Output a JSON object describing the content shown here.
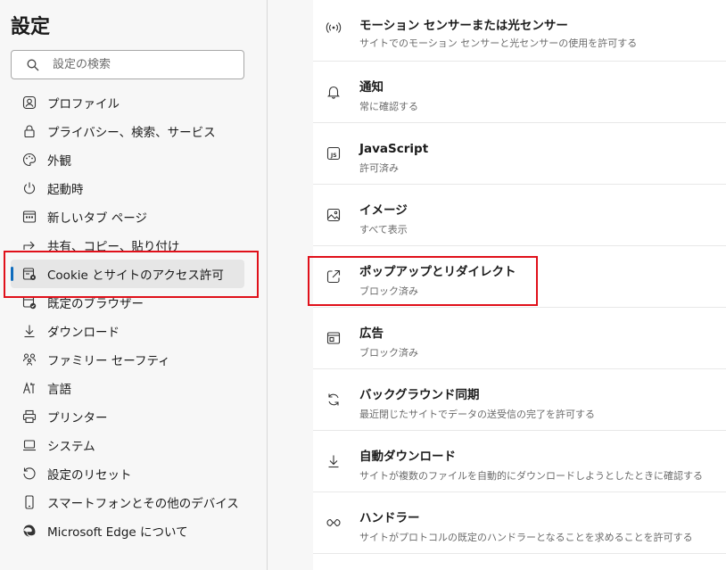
{
  "sidebar": {
    "title": "設定",
    "search_placeholder": "設定の検索",
    "items": [
      {
        "label": "プロファイル",
        "icon": "profile-icon"
      },
      {
        "label": "プライバシー、検索、サービス",
        "icon": "lock-icon"
      },
      {
        "label": "外観",
        "icon": "palette-icon"
      },
      {
        "label": "起動時",
        "icon": "power-icon"
      },
      {
        "label": "新しいタブ ページ",
        "icon": "new-tab-icon"
      },
      {
        "label": "共有、コピー、貼り付け",
        "icon": "share-icon"
      },
      {
        "label": "Cookie とサイトのアクセス許可",
        "icon": "site-permissions-icon",
        "active": true
      },
      {
        "label": "既定のブラウザー",
        "icon": "default-browser-icon"
      },
      {
        "label": "ダウンロード",
        "icon": "download-icon"
      },
      {
        "label": "ファミリー セーフティ",
        "icon": "family-icon"
      },
      {
        "label": "言語",
        "icon": "language-icon"
      },
      {
        "label": "プリンター",
        "icon": "printer-icon"
      },
      {
        "label": "システム",
        "icon": "laptop-icon"
      },
      {
        "label": "設定のリセット",
        "icon": "reset-icon"
      },
      {
        "label": "スマートフォンとその他のデバイス",
        "icon": "phone-icon"
      },
      {
        "label": "Microsoft Edge について",
        "icon": "edge-logo-icon"
      }
    ]
  },
  "settings": [
    {
      "title": "モーション センサーまたは光センサー",
      "desc": "サイトでのモーション センサーと光センサーの使用を許可する",
      "icon": "sensor-icon"
    },
    {
      "title": "通知",
      "desc": "常に確認する",
      "icon": "bell-icon"
    },
    {
      "title": "JavaScript",
      "desc": "許可済み",
      "icon": "javascript-icon"
    },
    {
      "title": "イメージ",
      "desc": "すべて表示",
      "icon": "image-icon"
    },
    {
      "title": "ポップアップとリダイレクト",
      "desc": "ブロック済み",
      "icon": "popup-icon"
    },
    {
      "title": "広告",
      "desc": "ブロック済み",
      "icon": "ads-icon"
    },
    {
      "title": "バックグラウンド同期",
      "desc": "最近閉じたサイトでデータの送受信の完了を許可する",
      "icon": "sync-icon"
    },
    {
      "title": "自動ダウンロード",
      "desc": "サイトが複数のファイルを自動的にダウンロードしようとしたときに確認する",
      "icon": "download-icon"
    },
    {
      "title": "ハンドラー",
      "desc": "サイトがプロトコルの既定のハンドラーとなることを求めることを許可する",
      "icon": "handler-icon"
    }
  ],
  "colors": {
    "accent": "#0f6cbd",
    "highlight": "#e0101a"
  }
}
